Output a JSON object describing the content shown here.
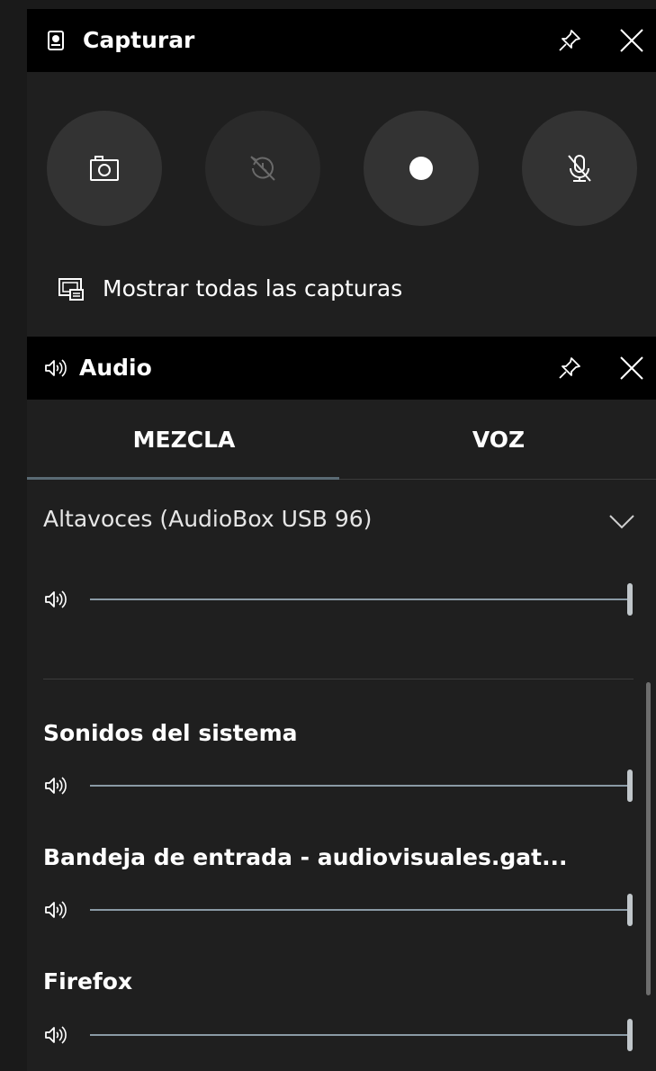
{
  "capture": {
    "title": "Capturar",
    "title_icon": "capture-widget-icon",
    "buttons": [
      {
        "name": "screenshot",
        "icon": "camera-icon",
        "enabled": true
      },
      {
        "name": "record-last",
        "icon": "record-last-disabled-icon",
        "enabled": false
      },
      {
        "name": "record",
        "icon": "record-dot-icon",
        "enabled": true
      },
      {
        "name": "mic",
        "icon": "mic-off-icon",
        "enabled": true
      }
    ],
    "show_all_label": "Mostrar todas las capturas"
  },
  "audio": {
    "title": "Audio",
    "tabs": [
      {
        "label": "MEZCLA",
        "active": true
      },
      {
        "label": "VOZ",
        "active": false
      }
    ],
    "device": {
      "name": "Altavoces (AudioBox USB 96)",
      "volume": 1.0
    },
    "apps": [
      {
        "name": "Sonidos del sistema",
        "volume": 1.0
      },
      {
        "name": "Bandeja de entrada - audiovisuales.gat...",
        "volume": 1.0
      },
      {
        "name": "Firefox",
        "volume": 1.0
      }
    ]
  },
  "colors": {
    "titlebar": "#000000",
    "panel": "#1f1f1f",
    "button": "#333333",
    "slider_track": "#566570",
    "slider_thumb": "#c0c6ca"
  }
}
